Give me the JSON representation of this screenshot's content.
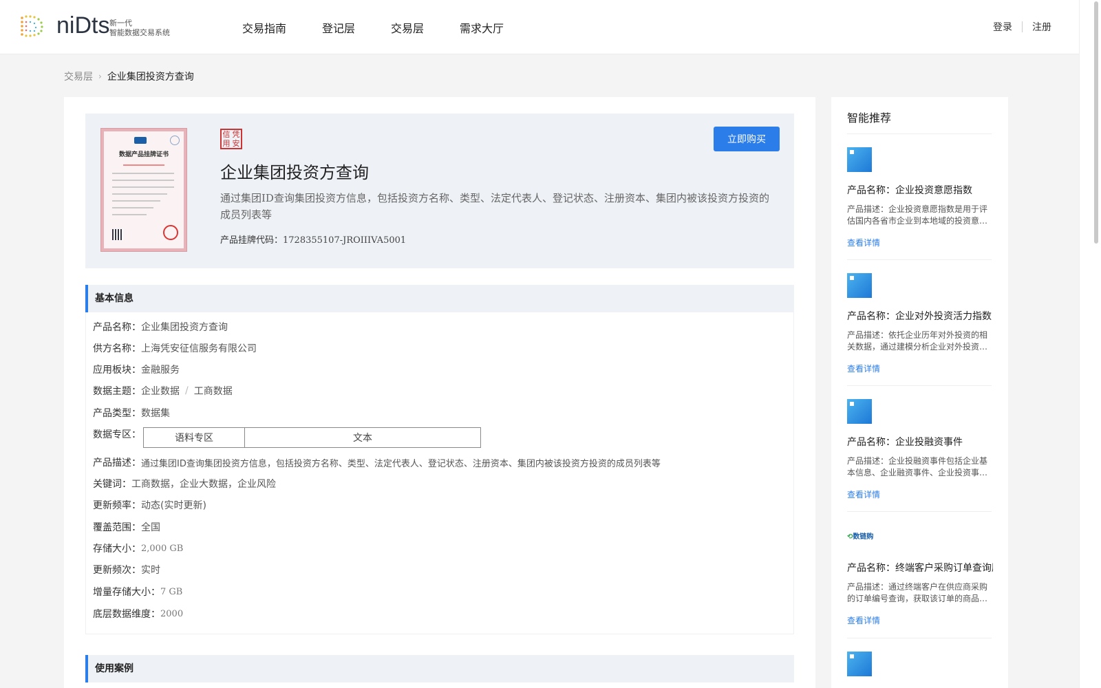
{
  "header": {
    "logo_word": "niDts",
    "logo_sub_1": "新一代",
    "logo_sub_2": "智能数据交易系统",
    "nav": [
      "交易指南",
      "登记层",
      "交易层",
      "需求大厅"
    ],
    "login": "登录",
    "register": "注册"
  },
  "breadcrumb": {
    "parent": "交易层",
    "current": "企业集团投资方查询"
  },
  "hero": {
    "cert_title": "数据产品挂牌证书",
    "credit_badge": [
      "信",
      "凭",
      "用",
      "安"
    ],
    "title": "企业集团投资方查询",
    "description": "通过集团ID查询集团投资方信息，包括投资方名称、类型、法定代表人、登记状态、注册资本、集团内被该投资方投资的成员列表等",
    "code_label": "产品挂牌代码：",
    "code_value": "1728355107-JROIIIVA5001",
    "buy_label": "立即购买"
  },
  "basic_info": {
    "heading": "基本信息",
    "product_name_label": "产品名称：",
    "product_name": "企业集团投资方查询",
    "supplier_label": "供方名称：",
    "supplier": "上海凭安征信服务有限公司",
    "sector_label": "应用板块：",
    "sector": "金融服务",
    "topic_label": "数据主题：",
    "topics": [
      "企业数据",
      "工商数据"
    ],
    "topic_sep": "/",
    "type_label": "产品类型：",
    "type": "数据集",
    "zone_label": "数据专区：",
    "zone_cells": [
      "语料专区",
      "文本"
    ],
    "desc_label": "产品描述：",
    "desc": "通过集团ID查询集团投资方信息，包括投资方名称、类型、法定代表人、登记状态、注册资本、集团内被该投资方投资的成员列表等",
    "keywords_label": "关键词：",
    "keywords": "工商数据，企业大数据，企业风险",
    "update_freq_label": "更新频率：",
    "update_freq": "动态(实时更新)",
    "coverage_label": "覆盖范围：",
    "coverage": "全国",
    "storage_label": "存储大小：",
    "storage": "2,000 GB",
    "update_times_label": "更新频次：",
    "update_times": "实时",
    "incr_label": "增量存储大小：",
    "incr": "7 GB",
    "dims_label": "底层数据维度：",
    "dims": "2000"
  },
  "use_case": {
    "heading": "使用案例"
  },
  "sidebar": {
    "title": "智能推荐",
    "items": [
      {
        "name": "产品名称：企业投资意愿指数",
        "desc": "产品描述：企业投资意愿指数是用于评估国内各省市企业到本地域的投资意…",
        "link": "查看详情"
      },
      {
        "name": "产品名称：企业对外投资活力指数",
        "desc": "产品描述：依托企业历年对外投资的相关数据，通过建模分析企业对外投资…",
        "link": "查看详情"
      },
      {
        "name": "产品名称：企业投融资事件",
        "desc": "产品描述：企业投融资事件包括企业基本信息、企业融资事件、企业投资事…",
        "link": "查看详情"
      },
      {
        "name": "产品名称：终端客户采购订单查询服务",
        "desc": "产品描述：通过终端客户在供应商采购的订单编号查询，获取该订单的商品…",
        "link": "查看详情",
        "logo_text": "数链购"
      }
    ]
  }
}
